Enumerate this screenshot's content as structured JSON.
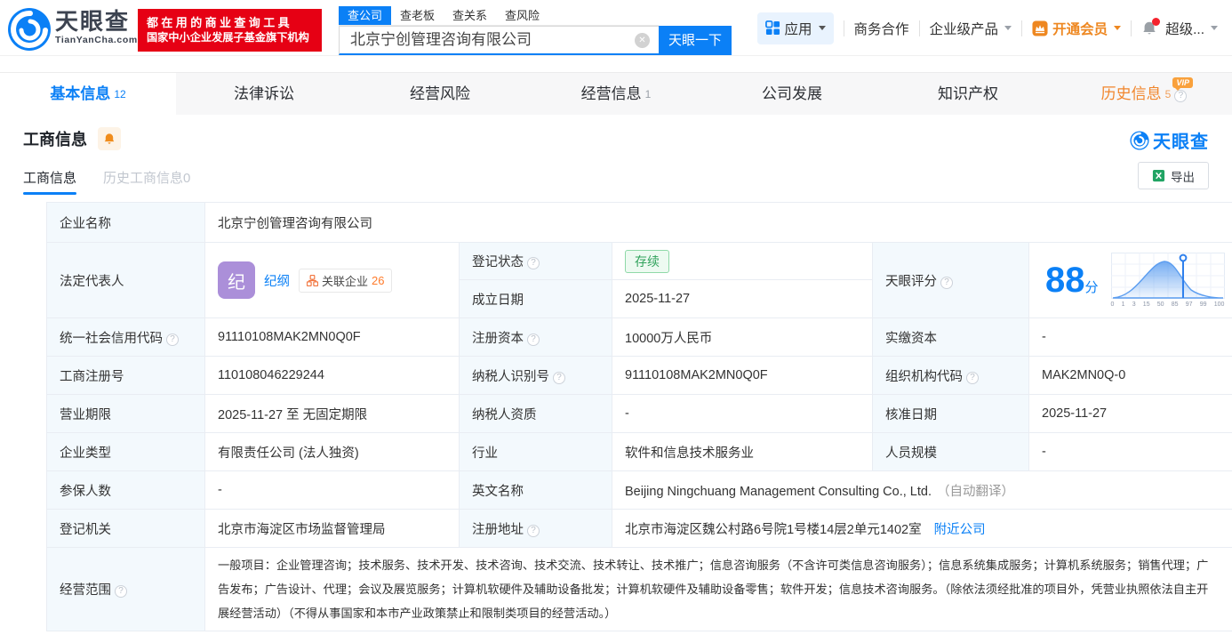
{
  "brand": {
    "name_cn": "天眼查",
    "domain": "TianYanCha.com",
    "slogan_line1": "都在用的商业查询工具",
    "slogan_line2": "国家中小企业发展子基金旗下机构"
  },
  "search": {
    "tabs": [
      "查公司",
      "查老板",
      "查关系",
      "查风险"
    ],
    "value": "北京宁创管理咨询有限公司",
    "button": "天眼一下"
  },
  "header_menu": {
    "app": "应用",
    "cooperation": "商务合作",
    "enterprise": "企业级产品",
    "vip": "开通会员",
    "super": "超级..."
  },
  "nav_tabs": [
    {
      "label": "基本信息",
      "count": "12"
    },
    {
      "label": "法律诉讼",
      "count": ""
    },
    {
      "label": "经营风险",
      "count": ""
    },
    {
      "label": "经营信息",
      "count": "1"
    },
    {
      "label": "公司发展",
      "count": ""
    },
    {
      "label": "知识产权",
      "count": ""
    },
    {
      "label": "历史信息",
      "count": "5",
      "vip": "VIP"
    }
  ],
  "section": {
    "title": "工商信息",
    "tab_current": "工商信息",
    "tab_history": "历史工商信息0",
    "export": "导出",
    "watermark": "天眼查"
  },
  "score": {
    "label": "天眼评分",
    "value": "88",
    "unit": "分",
    "axis": [
      "0",
      "1",
      "3",
      "15",
      "50",
      "85",
      "97",
      "99",
      "100"
    ]
  },
  "fields": {
    "company_name_label": "企业名称",
    "company_name": "北京宁创管理咨询有限公司",
    "legal_rep_label": "法定代表人",
    "legal_rep_avatar": "纪",
    "legal_rep_name": "纪纲",
    "related_label": "关联企业",
    "related_count": "26",
    "reg_status_label": "登记状态",
    "reg_status": "存续",
    "establish_label": "成立日期",
    "establish_date": "2025-11-27",
    "credit_code_label": "统一社会信用代码",
    "credit_code": "91110108MAK2MN0Q0F",
    "reg_capital_label": "注册资本",
    "reg_capital": "10000万人民币",
    "paid_capital_label": "实缴资本",
    "paid_capital": "-",
    "reg_number_label": "工商注册号",
    "reg_number": "110108046229244",
    "taxpayer_id_label": "纳税人识别号",
    "taxpayer_id": "91110108MAK2MN0Q0F",
    "org_code_label": "组织机构代码",
    "org_code": "MAK2MN0Q-0",
    "business_term_label": "营业期限",
    "business_term": "2025-11-27 至 无固定期限",
    "taxpayer_quality_label": "纳税人资质",
    "taxpayer_quality": "-",
    "approve_date_label": "核准日期",
    "approve_date": "2025-11-27",
    "company_type_label": "企业类型",
    "company_type": "有限责任公司 (法人独资)",
    "industry_label": "行业",
    "industry": "软件和信息技术服务业",
    "staff_size_label": "人员规模",
    "staff_size": "-",
    "insured_label": "参保人数",
    "insured": "-",
    "english_name_label": "英文名称",
    "english_name": "Beijing Ningchuang Management Consulting Co., Ltd.",
    "english_name_note": "（自动翻译）",
    "reg_authority_label": "登记机关",
    "reg_authority": "北京市海淀区市场监督管理局",
    "reg_address_label": "注册地址",
    "reg_address": "北京市海淀区魏公村路6号院1号楼14层2单元1402室",
    "nearby_link": "附近公司",
    "business_scope_label": "经营范围",
    "business_scope": "一般项目：企业管理咨询；技术服务、技术开发、技术咨询、技术交流、技术转让、技术推广；信息咨询服务（不含许可类信息咨询服务）；信息系统集成服务；计算机系统服务；销售代理；广告发布；广告设计、代理；会议及展览服务；计算机软硬件及辅助设备批发；计算机软硬件及辅助设备零售；软件开发；信息技术咨询服务。（除依法须经批准的项目外，凭营业执照依法自主开展经营活动）（不得从事国家和本市产业政策禁止和限制类项目的经营活动。）"
  }
}
